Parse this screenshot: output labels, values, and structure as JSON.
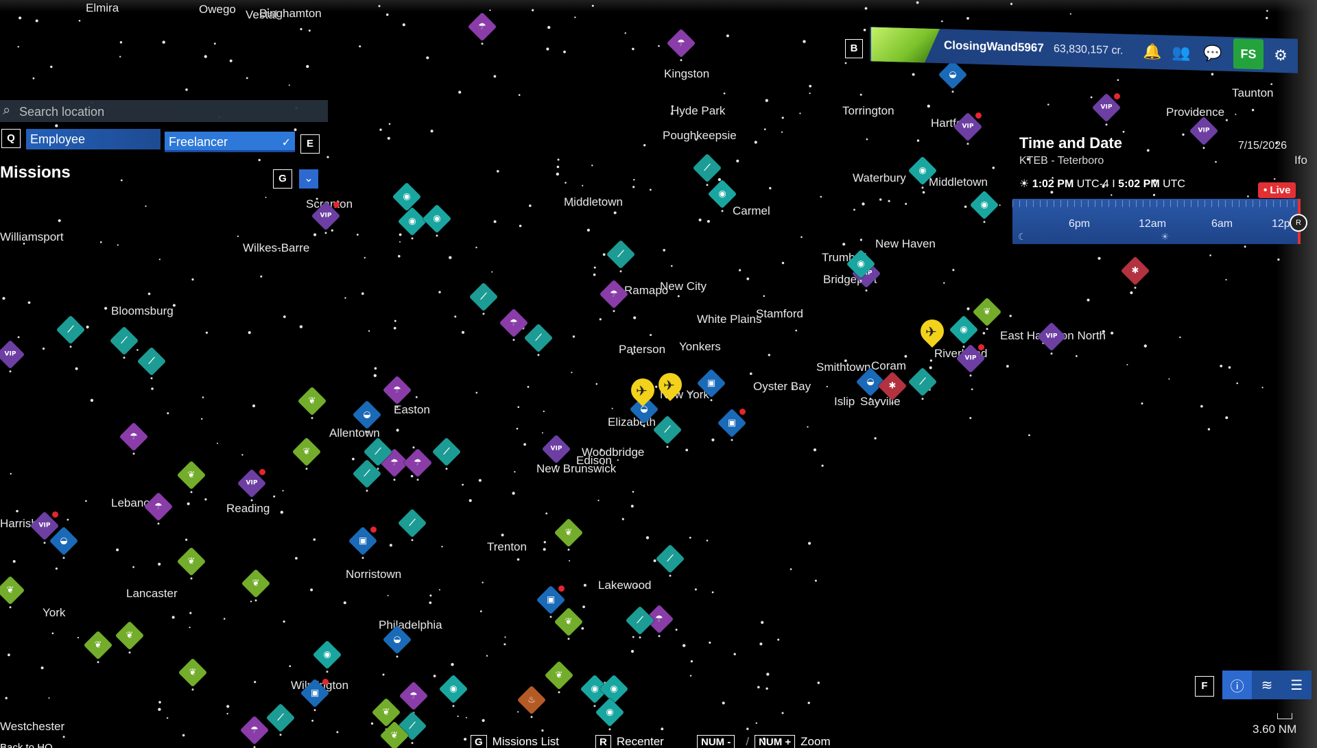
{
  "header": {
    "username": "ClosingWand5967",
    "credits": "63,830,157 cr.",
    "key_b": "B",
    "shop_label": "FS"
  },
  "time_panel": {
    "title": "Time and Date",
    "airport": "KTEB - Teterboro",
    "date": "7/15/2026",
    "local_time": "1:02 PM",
    "local_tz": "UTC-4 I",
    "utc_time": "5:02 PM",
    "utc_label": "UTC",
    "live": "Live",
    "timeline_labels": [
      "6pm",
      "12am",
      "6am",
      "12p"
    ]
  },
  "left_panel": {
    "search_placeholder": "Search location",
    "key_q": "Q",
    "key_e": "E",
    "key_g": "G",
    "tab_employee": "Employee",
    "tab_freelancer": "Freelancer",
    "missions_title": "Missions"
  },
  "bottom_bar": {
    "key_g": "G",
    "missions_list": "Missions List",
    "key_r": "R",
    "recenter": "Recenter",
    "key_num_minus": "NUM -",
    "slash": "/",
    "key_num_plus": "NUM +",
    "zoom": "Zoom",
    "key_f": "F",
    "scale": "3.60 NM",
    "back_to_hq": "Back to HQ"
  },
  "cities": {
    "elmira": "Elmira",
    "owego": "Owego",
    "binghamton": "Binghamton",
    "vestal": "Vestal",
    "kingston": "Kingston",
    "hyde_park": "Hyde Park",
    "poughkeepsie": "Poughkeepsie",
    "torrington": "Torrington",
    "hartford": "Hartford",
    "providence": "Providence",
    "taunton": "Taunton",
    "waterbury": "Waterbury",
    "middletown_ct": "Middletown",
    "middletown_ny": "Middletown",
    "carmel": "Carmel",
    "scranton": "Scranton",
    "williamsport": "Williamsport",
    "wilkes_barre": "Wilkes-Barre",
    "new_haven": "New Haven",
    "trumbull": "Trumbull",
    "bridgeport": "Bridgeport",
    "ramapo": "Ramapo",
    "new_city": "New City",
    "white_plains": "White Plains",
    "stamford": "Stamford",
    "bloomsburg": "Bloomsburg",
    "paterson": "Paterson",
    "yonkers": "Yonkers",
    "new_york": "New York",
    "oyster_bay": "Oyster Bay",
    "smithtown": "Smithtown",
    "coram": "Coram",
    "riverhead": "Riverhead",
    "east_hampton_north": "East Hampton North",
    "islip": "Islip",
    "sayville": "Sayville",
    "easton": "Easton",
    "allentown": "Allentown",
    "elizabeth": "Elizabeth",
    "woodbridge": "Woodbridge",
    "edison": "Edison",
    "new_brunswick": "New Brunswick",
    "lebanon": "Lebanon",
    "reading": "Reading",
    "harrisburg": "Harrisburg",
    "trenton": "Trenton",
    "norristown": "Norristown",
    "lakewood": "Lakewood",
    "lancaster": "Lancaster",
    "york": "York",
    "philadelphia": "Philadelphia",
    "wilmington": "Wilmington",
    "westchester": "Westchester",
    "ifo": "Ifo"
  },
  "icons": {
    "vip": "VIP",
    "para": "☂",
    "photo": "◉",
    "leaf": "⟋",
    "crop": "❦",
    "cargo": "▣",
    "pass": "◒",
    "red": "✱",
    "fire": "♨"
  },
  "colors": {
    "vip": "#6d3fa3",
    "photo": "#1aa6a0",
    "crop": "#73ad2b",
    "cargo": "#1a6ab8",
    "live": "#e23034",
    "shop": "#24a33c",
    "airport": "#f2d21b"
  }
}
